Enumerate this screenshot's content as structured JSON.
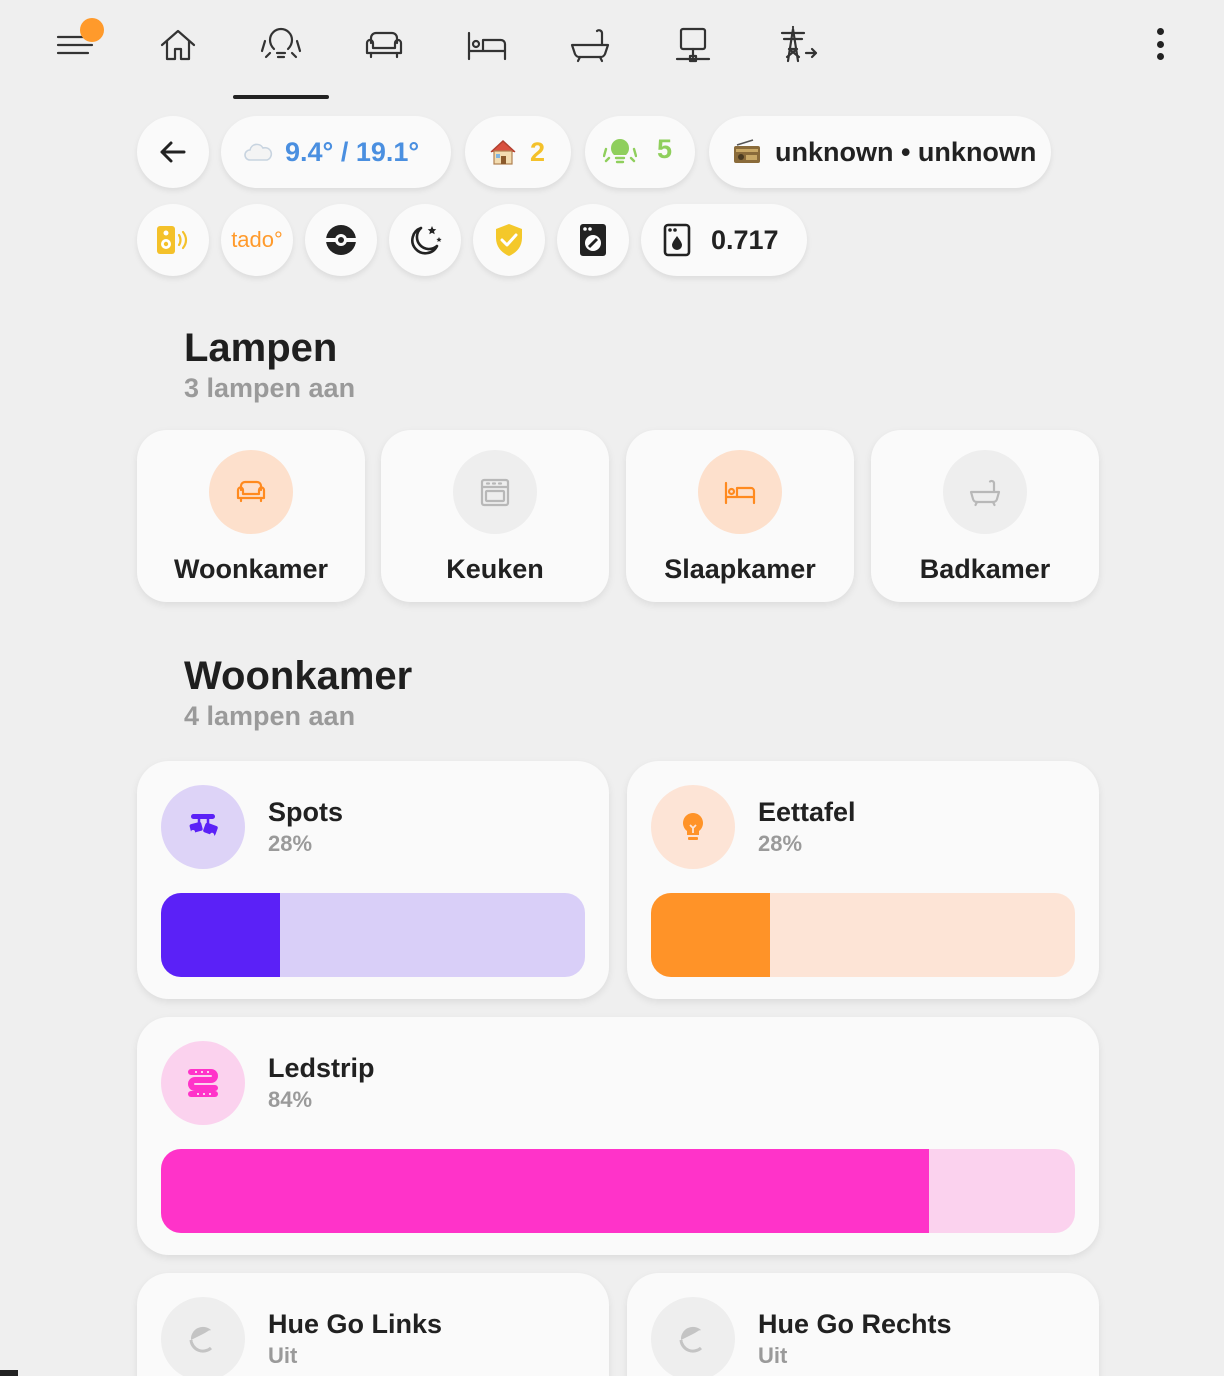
{
  "nav": {
    "tabs": [
      "home",
      "lights",
      "living-room",
      "bedroom",
      "bathroom",
      "network",
      "energy"
    ],
    "active_tab": "lights"
  },
  "chips": {
    "weather": "9.4° / 19.1°",
    "home_count": "2",
    "lights_count": "5",
    "media": "unknown • unknown",
    "tado_label": "tado°",
    "sensor_value": "0.717"
  },
  "lampen": {
    "title": "Lampen",
    "subtitle": "3 lampen aan",
    "rooms": [
      {
        "name": "Woonkamer",
        "on": true
      },
      {
        "name": "Keuken",
        "on": false
      },
      {
        "name": "Slaapkamer",
        "on": true
      },
      {
        "name": "Badkamer",
        "on": false
      }
    ]
  },
  "woonkamer": {
    "title": "Woonkamer",
    "subtitle": "4 lampen aan",
    "lights": [
      {
        "name": "Spots",
        "value": "28%",
        "level": 0.28,
        "color": "#5b21f7",
        "track": "#d9cff8",
        "bg": "#ddd3f7"
      },
      {
        "name": "Eettafel",
        "value": "28%",
        "level": 0.28,
        "color": "#ff9328",
        "track": "#fde4d6",
        "bg": "#fde4d6"
      },
      {
        "name": "Ledstrip",
        "value": "84%",
        "level": 0.84,
        "color": "#ff33c9",
        "track": "#fbd2ee",
        "bg": "#fbd2ee"
      },
      {
        "name": "Hue Go Links",
        "value": "Uit"
      },
      {
        "name": "Hue Go Rechts",
        "value": "Uit"
      }
    ]
  },
  "colors": {
    "accent_orange": "#ff9a2b",
    "weather_blue": "#4a8fe0",
    "home_yellow": "#f4c12a",
    "lights_green": "#8fcf5c"
  }
}
